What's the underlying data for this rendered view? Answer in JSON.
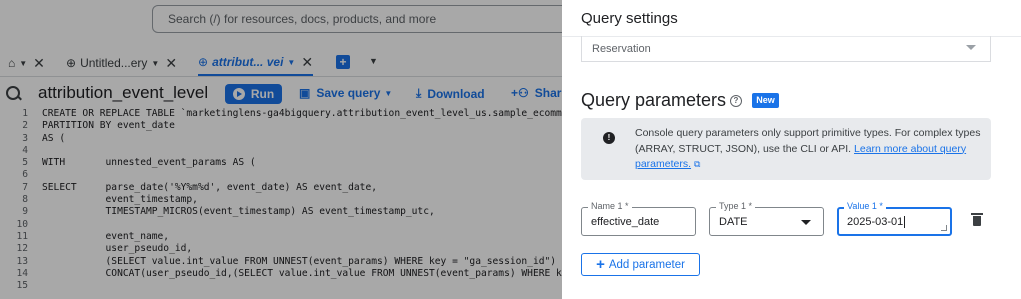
{
  "search": {
    "placeholder": "Search (/) for resources, docs, products, and more"
  },
  "tabs": [
    {
      "label": "Untitled...ery"
    },
    {
      "label": "attribut... vei"
    }
  ],
  "toolbar": {
    "query_title": "attribution_event_level",
    "run_label": "Run",
    "save_label": "Save query",
    "download_label": "Download",
    "share_label": "Share"
  },
  "code_lines": [
    {
      "n": "1",
      "text": "CREATE OR REPLACE TABLE `marketinglens-ga4bigquery.attribution_event_level_us.sample_ecomm"
    },
    {
      "n": "2",
      "text": "PARTITION BY event_date"
    },
    {
      "n": "3",
      "text": "AS ("
    },
    {
      "n": "4",
      "text": ""
    },
    {
      "n": "5",
      "text": "WITH       unnested_event_params AS ("
    },
    {
      "n": "6",
      "text": ""
    },
    {
      "n": "7",
      "text": "SELECT     parse_date('%Y%m%d', event_date) AS event_date,"
    },
    {
      "n": "8",
      "text": "           event_timestamp,"
    },
    {
      "n": "9",
      "text": "           TIMESTAMP_MICROS(event_timestamp) AS event_timestamp_utc,"
    },
    {
      "n": "10",
      "text": ""
    },
    {
      "n": "11",
      "text": "           event_name,"
    },
    {
      "n": "12",
      "text": "           user_pseudo_id,"
    },
    {
      "n": "13",
      "text": "           (SELECT value.int_value FROM UNNEST(event_params) WHERE key = \"ga_session_id\") AS"
    },
    {
      "n": "14",
      "text": "           CONCAT(user_pseudo_id,(SELECT value.int_value FROM UNNEST(event_params) WHERE key"
    },
    {
      "n": "15",
      "text": ""
    }
  ],
  "panel": {
    "title": "Query settings",
    "reservation_label": "Reservation",
    "params_title": "Query parameters",
    "new_badge": "New",
    "info_text": "Console query parameters only support primitive types. For complex types (ARRAY, STRUCT, JSON), use the CLI or API.",
    "info_link": "Learn more about query parameters.",
    "param": {
      "name_label": "Name 1 *",
      "name_value": "effective_date",
      "type_label": "Type 1 *",
      "type_value": "DATE",
      "value_label": "Value 1 *",
      "value_value": "2025-03-01"
    },
    "add_label": "Add parameter"
  }
}
